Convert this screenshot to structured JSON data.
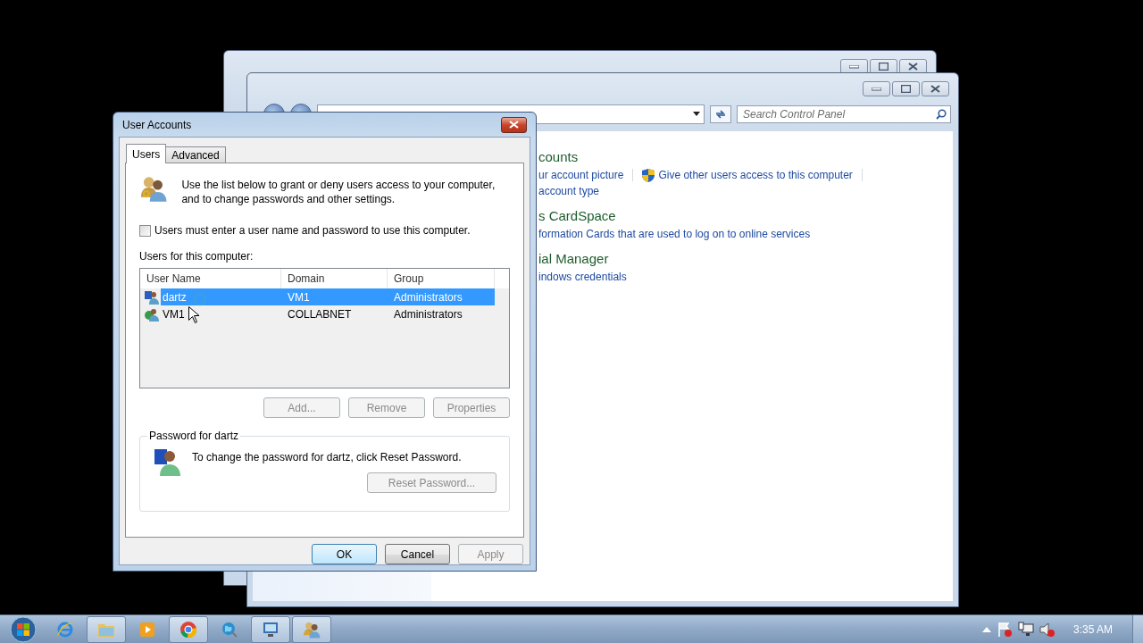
{
  "control_panel": {
    "search": {
      "placeholder": "Search Control Panel"
    },
    "sections": [
      {
        "title": "counts",
        "lines": [
          [
            {
              "kind": "link",
              "text": "ur account picture"
            },
            {
              "kind": "shield-link",
              "text": "Give other users access to this computer"
            }
          ],
          [
            {
              "kind": "link",
              "text": "account type"
            }
          ]
        ]
      },
      {
        "title": "s CardSpace",
        "lines": [
          [
            {
              "kind": "link",
              "text": "formation Cards that are used to log on to online services"
            }
          ]
        ]
      },
      {
        "title": "ial Manager",
        "lines": [
          [
            {
              "kind": "link",
              "text": "indows credentials"
            }
          ]
        ]
      }
    ]
  },
  "dialog": {
    "title": "User Accounts",
    "tabs": [
      {
        "label": "Users",
        "selected": true
      },
      {
        "label": "Advanced",
        "selected": false
      }
    ],
    "intro": "Use the list below to grant or deny users access to your computer, and to change passwords and other settings.",
    "checkbox": {
      "label": "Users must enter a user name and password to use this computer.",
      "checked": false
    },
    "list_label": "Users for this computer:",
    "columns": [
      "User Name",
      "Domain",
      "Group"
    ],
    "rows": [
      {
        "cells": [
          "dartz",
          "VM1",
          "Administrators"
        ],
        "selected": true
      },
      {
        "cells": [
          "VM1",
          "COLLABNET",
          "Administrators"
        ],
        "selected": false
      }
    ],
    "list_buttons": [
      {
        "label": "Add...",
        "disabled": true
      },
      {
        "label": "Remove",
        "disabled": true
      },
      {
        "label": "Properties",
        "disabled": true
      }
    ],
    "password_group": {
      "legend": "Password for dartz",
      "text": "To change the password for dartz, click Reset Password.",
      "button": {
        "label": "Reset Password...",
        "disabled": true
      }
    },
    "footer_buttons": [
      {
        "label": "OK",
        "disabled": false,
        "default": true
      },
      {
        "label": "Cancel",
        "disabled": false,
        "default": false
      },
      {
        "label": "Apply",
        "disabled": true,
        "default": false
      }
    ]
  },
  "taskbar": {
    "items": [
      {
        "kind": "browser-e",
        "running": false
      },
      {
        "kind": "folder",
        "running": true
      },
      {
        "kind": "media",
        "running": false
      },
      {
        "kind": "chrome",
        "running": true
      },
      {
        "kind": "globe",
        "running": false
      },
      {
        "kind": "monitor",
        "running": true
      },
      {
        "kind": "users",
        "running": true
      }
    ],
    "clock": "3:35 AM"
  }
}
